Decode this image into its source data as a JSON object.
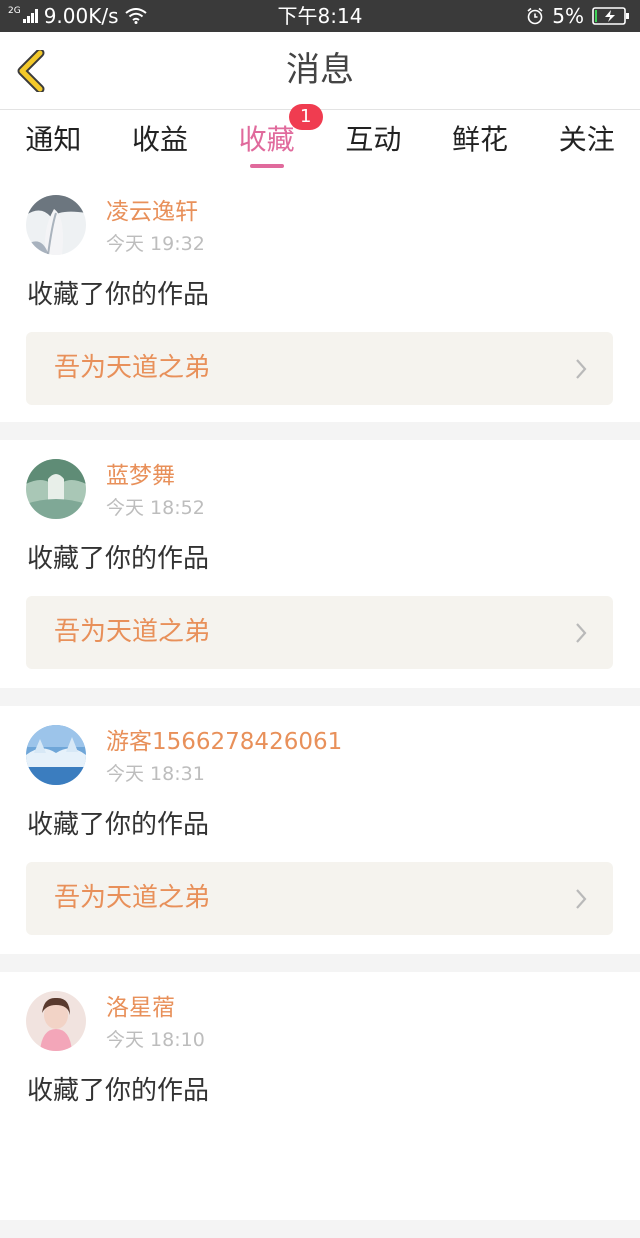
{
  "status_bar": {
    "network_type": "2G",
    "speed": "9.00K/s",
    "time": "下午8:14",
    "battery": "5%"
  },
  "header": {
    "title": "消息"
  },
  "tabs": [
    {
      "label": "通知"
    },
    {
      "label": "收益"
    },
    {
      "label": "收藏",
      "badge": "1",
      "active": true
    },
    {
      "label": "互动"
    },
    {
      "label": "鲜花"
    },
    {
      "label": "关注"
    }
  ],
  "messages": [
    {
      "username": "凌云逸轩",
      "time": "今天 19:32",
      "action": "收藏了你的作品",
      "work": "吾为天道之弟"
    },
    {
      "username": "蓝梦舞",
      "time": "今天 18:52",
      "action": "收藏了你的作品",
      "work": "吾为天道之弟"
    },
    {
      "username": "游客1566278426061",
      "time": "今天 18:31",
      "action": "收藏了你的作品",
      "work": "吾为天道之弟"
    },
    {
      "username": "洛星蓿",
      "time": "今天 18:10",
      "action": "收藏了你的作品"
    }
  ],
  "colors": {
    "accent_pink": "#e06a9c",
    "orange_text": "#e8905a",
    "badge_red": "#f03c50",
    "back_icon_yellow": "#f3c92a"
  }
}
